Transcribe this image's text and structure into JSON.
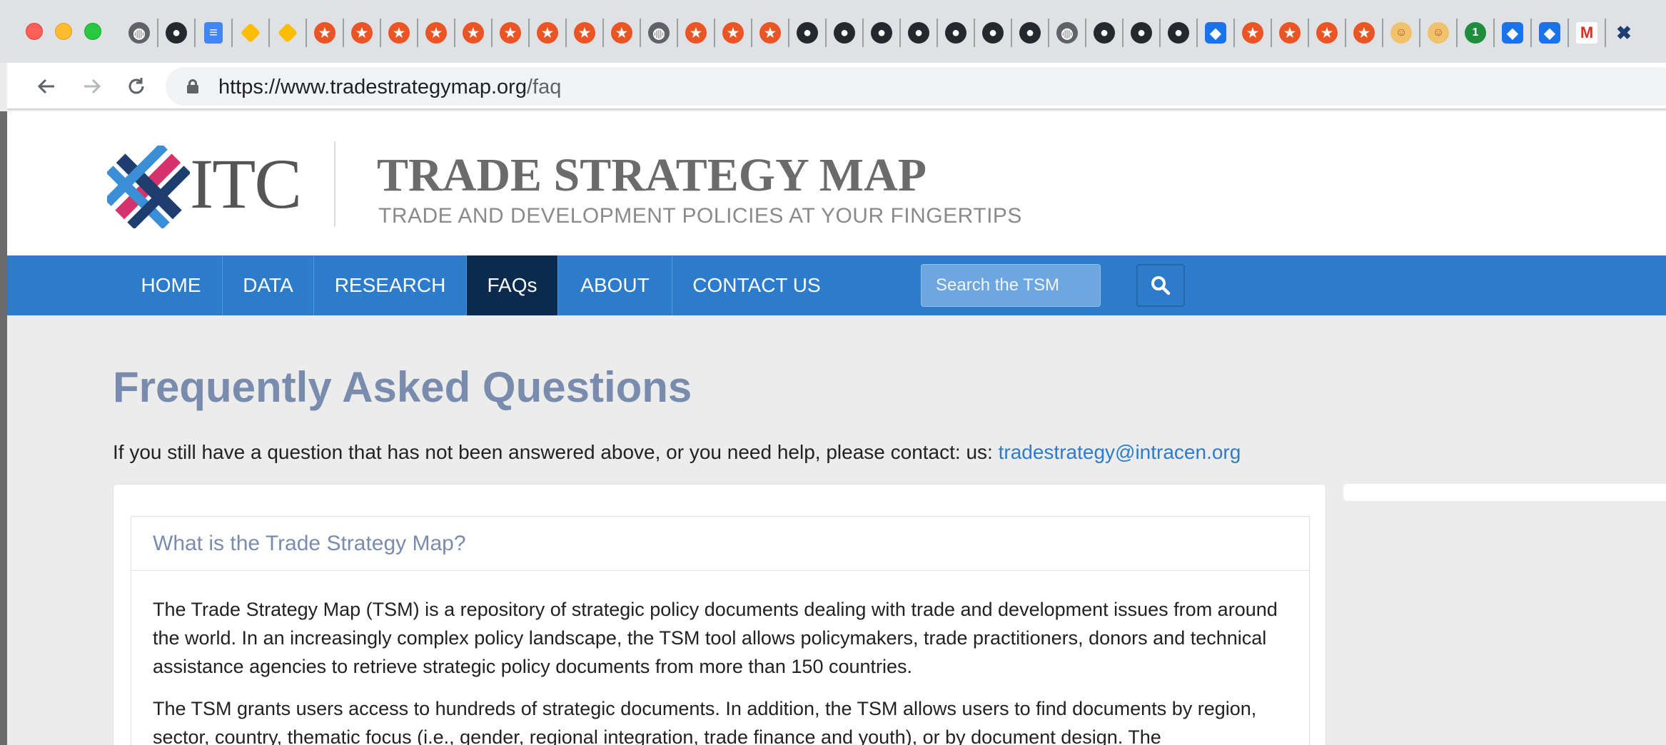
{
  "browser": {
    "url_host": "https://www.tradestrategymap.org",
    "url_path": "/faq",
    "pinned_tabs": [
      "globe-icon",
      "github-icon",
      "docs-icon",
      "pinwheel-icon",
      "pinwheel-icon",
      "auth0-icon",
      "auth0-icon",
      "auth0-icon",
      "auth0-icon",
      "auth0-icon",
      "auth0-icon",
      "auth0-icon",
      "auth0-icon",
      "auth0-icon",
      "globe-icon",
      "auth0-icon",
      "auth0-icon",
      "auth0-icon",
      "github-icon",
      "github-icon",
      "github-icon",
      "github-icon",
      "github-icon",
      "github-icon",
      "github-icon",
      "globe-icon",
      "github-icon",
      "github-icon",
      "github-icon",
      "app-icon",
      "auth0-icon",
      "auth0-icon",
      "auth0-icon",
      "auth0-icon",
      "face-icon",
      "face-icon",
      "badge-1-icon",
      "app-icon",
      "app-icon",
      "gmail-icon",
      "itc-icon"
    ]
  },
  "header": {
    "logo_text": "ITC",
    "title": "TRADE STRATEGY MAP",
    "tagline": "TRADE AND DEVELOPMENT POLICIES AT YOUR FINGERTIPS"
  },
  "nav": {
    "items": [
      {
        "label": "HOME"
      },
      {
        "label": "DATA"
      },
      {
        "label": "RESEARCH"
      },
      {
        "label": "FAQs"
      },
      {
        "label": "ABOUT"
      },
      {
        "label": "CONTACT US"
      }
    ],
    "active": "FAQs",
    "search_placeholder": "Search the TSM"
  },
  "main": {
    "title": "Frequently Asked Questions",
    "help_text": "If you still have a question that has not been answered above, or you need help, please contact: us: ",
    "help_email": "tradestrategy@intracen.org",
    "faqs": [
      {
        "question": "What is the Trade Strategy Map?",
        "answer_p1": "The Trade Strategy Map (TSM) is a repository of strategic policy documents dealing with trade and development issues from around the world. In an increasingly complex policy landscape, the TSM tool allows policymakers, trade practitioners, donors and technical assistance agencies to retrieve strategic policy documents from more than 150 countries.",
        "answer_p2": "The TSM grants users access to hundreds of strategic documents. In addition, the TSM allows users to find documents by region, sector, country, thematic focus (i.e., gender, regional integration, trade finance and youth), or by document design. The"
      }
    ]
  },
  "colors": {
    "nav_bg": "#2d7ccb",
    "nav_active": "#0b2b4e",
    "heading": "#7a8cad",
    "link": "#2d7ccb",
    "logo_pink": "#d6336c",
    "logo_navy": "#1d3e6f",
    "logo_blue": "#3a8fd6"
  }
}
